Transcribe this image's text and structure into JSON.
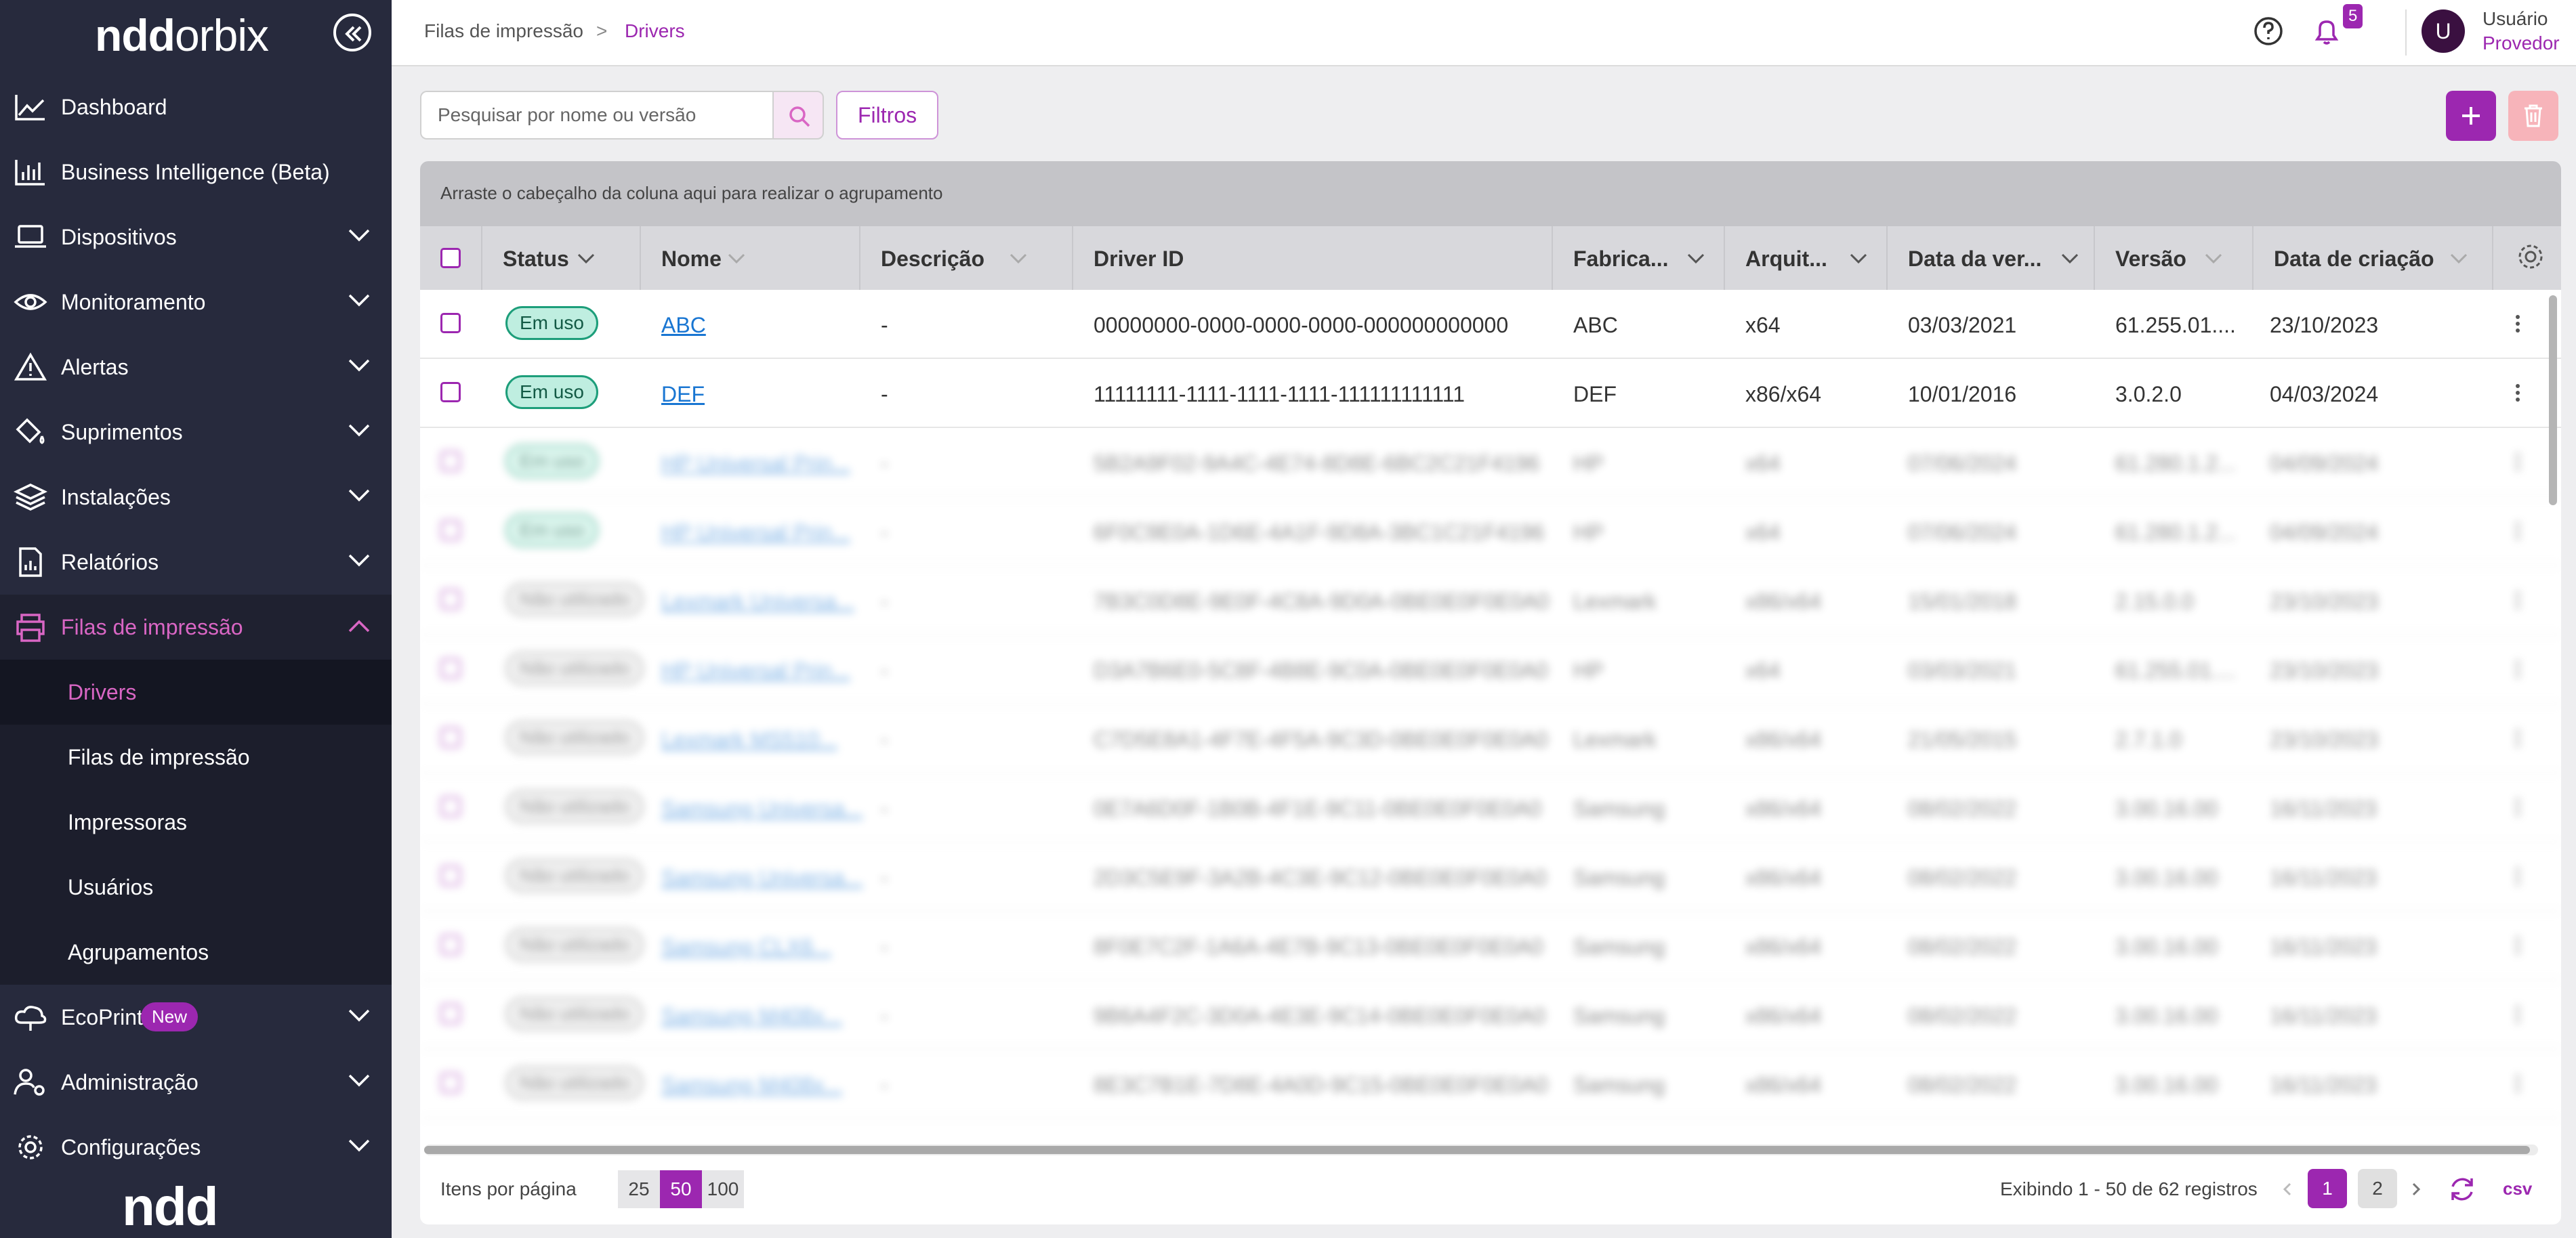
{
  "app": {
    "logo_ndd": "ndd",
    "logo_orbix": "orbix",
    "footer_logo": "ndd"
  },
  "sidebar": {
    "items": [
      {
        "label": "Dashboard",
        "icon": "chart-line-icon"
      },
      {
        "label": "Business Intelligence (Beta)",
        "icon": "bar-chart-icon"
      },
      {
        "label": "Dispositivos",
        "icon": "laptop-icon"
      },
      {
        "label": "Monitoramento",
        "icon": "eye-icon"
      },
      {
        "label": "Alertas",
        "icon": "warning-icon"
      },
      {
        "label": "Suprimentos",
        "icon": "paint-bucket-icon"
      },
      {
        "label": "Instalações",
        "icon": "layers-icon"
      },
      {
        "label": "Relatórios",
        "icon": "report-icon"
      },
      {
        "label": "Filas de impressão",
        "icon": "printer-icon"
      },
      {
        "label": "EcoPrint",
        "icon": "eco-cloud-icon"
      },
      {
        "label": "Administração",
        "icon": "users-admin-icon"
      },
      {
        "label": "Configurações",
        "icon": "gear-icon"
      }
    ],
    "subitems": [
      "Drivers",
      "Filas de impressão",
      "Impressoras",
      "Usuários",
      "Agrupamentos"
    ],
    "new_badge": "New"
  },
  "breadcrumb": {
    "parent": "Filas de impressão",
    "separator": ">",
    "current": "Drivers"
  },
  "header": {
    "notifications": "5",
    "user_initial": "U",
    "user_name": "Usuário",
    "user_role": "Provedor"
  },
  "toolbar": {
    "search_placeholder": "Pesquisar por nome ou versão",
    "filters_label": "Filtros"
  },
  "grid": {
    "group_hint": "Arraste o cabeçalho da coluna aqui para realizar o agrupamento",
    "columns": [
      "Status",
      "Nome",
      "Descrição",
      "Driver ID",
      "Fabrica...",
      "Arquit...",
      "Data da ver...",
      "Versão",
      "Data de criação"
    ],
    "rows": [
      {
        "status": "Em uso",
        "nome": "ABC",
        "descricao": "-",
        "driver_id": "00000000-0000-0000-0000-000000000000",
        "fabricante": "ABC",
        "arquitetura": "x64",
        "data_versao": "03/03/2021",
        "versao": "61.255.01....",
        "data_criacao": "23/10/2023"
      },
      {
        "status": "Em uso",
        "nome": "DEF",
        "descricao": "-",
        "driver_id": "11111111-1111-1111-1111-111111111111",
        "fabricante": "DEF",
        "arquitetura": "x86/x64",
        "data_versao": "10/01/2016",
        "versao": "3.0.2.0",
        "data_criacao": "04/03/2024"
      },
      {
        "status": "Em uso",
        "nome": "HP Universal Prin...",
        "descricao": "-",
        "driver_id": "5B2A9F02-9A4C-4E74-8D8E-6BC2C21F4196",
        "fabricante": "HP",
        "arquitetura": "x64",
        "data_versao": "07/06/2024",
        "versao": "61.280.1.2...",
        "data_criacao": "04/09/2024"
      },
      {
        "status": "Em uso",
        "nome": "HP Universal Prin...",
        "descricao": "-",
        "driver_id": "6F0C9E0A-1D6E-4A1F-9D8A-3BC1C21F4196",
        "fabricante": "HP",
        "arquitetura": "x64",
        "data_versao": "07/06/2024",
        "versao": "61.280.1.2...",
        "data_criacao": "04/09/2024"
      },
      {
        "status": "Não utilizado",
        "nome": "Lexmark Universa...",
        "descricao": "-",
        "driver_id": "7B3C0D8E-9E0F-4C8A-9D0A-0BE0E0F0E0A0",
        "fabricante": "Lexmark",
        "arquitetura": "x86/x64",
        "data_versao": "15/01/2018",
        "versao": "2.15.0.0",
        "data_criacao": "23/10/2023"
      },
      {
        "status": "Não utilizado",
        "nome": "HP Universal Prin...",
        "descricao": "-",
        "driver_id": "D3A7B6E0-5C8F-4B8E-9C0A-0BE0E0F0E0A0",
        "fabricante": "HP",
        "arquitetura": "x64",
        "data_versao": "03/03/2021",
        "versao": "61.255.01....",
        "data_criacao": "23/10/2023"
      },
      {
        "status": "Não utilizado",
        "nome": "Lexmark MS510...",
        "descricao": "-",
        "driver_id": "C7D5E8A1-4F7E-4F5A-9C3D-0BE0E0F0E0A0",
        "fabricante": "Lexmark",
        "arquitetura": "x86/x64",
        "data_versao": "21/05/2015",
        "versao": "2.7.1.0",
        "data_criacao": "23/10/2023"
      },
      {
        "status": "Não utilizado",
        "nome": "Samsung Universa...",
        "descricao": "-",
        "driver_id": "0E7A6D0F-1B0B-4F1E-9C11-0BE0E0F0E0A0",
        "fabricante": "Samsung",
        "arquitetura": "x86/x64",
        "data_versao": "08/02/2022",
        "versao": "3.00.16.00",
        "data_criacao": "16/11/2023"
      },
      {
        "status": "Não utilizado",
        "nome": "Samsung Universa...",
        "descricao": "-",
        "driver_id": "2D3C5E9F-3A2B-4C3E-9C12-0BE0E0F0E0A0",
        "fabricante": "Samsung",
        "arquitetura": "x86/x64",
        "data_versao": "08/02/2022",
        "versao": "3.00.16.00",
        "data_criacao": "16/11/2023"
      },
      {
        "status": "Não utilizado",
        "nome": "Samsung CLX6...",
        "descricao": "-",
        "driver_id": "8F0E7C2F-1A6A-4E7B-9C13-0BE0E0F0E0A0",
        "fabricante": "Samsung",
        "arquitetura": "x86/x64",
        "data_versao": "08/02/2022",
        "versao": "3.00.16.00",
        "data_criacao": "16/11/2023"
      },
      {
        "status": "Não utilizado",
        "nome": "Samsung M408x...",
        "descricao": "-",
        "driver_id": "9B6A4F2C-3D0A-4E3E-9C14-0BE0E0F0E0A0",
        "fabricante": "Samsung",
        "arquitetura": "x86/x64",
        "data_versao": "08/02/2022",
        "versao": "3.00.16.00",
        "data_criacao": "16/11/2023"
      },
      {
        "status": "Não utilizado",
        "nome": "Samsung M408x...",
        "descricao": "-",
        "driver_id": "8E3C7B1E-7D8E-4A0D-9C15-0BE0E0F0E0A0",
        "fabricante": "Samsung",
        "arquitetura": "x86/x64",
        "data_versao": "08/02/2022",
        "versao": "3.00.16.00",
        "data_criacao": "16/11/2023"
      }
    ]
  },
  "pager": {
    "items_label": "Itens por página",
    "sizes": [
      "25",
      "50",
      "100"
    ],
    "selected_size": "50",
    "showing": "Exibindo  1 - 50 de 62 registros",
    "pages": [
      "1",
      "2"
    ],
    "current_page": "1",
    "csv_label": "csv"
  },
  "colors": {
    "accent": "#9c27b0",
    "sidebar_bg": "#272a3d",
    "status_border": "#1d9e7a",
    "status_fill": "#bfeee0",
    "link": "#1976d2",
    "delete": "#f7b4ba"
  }
}
